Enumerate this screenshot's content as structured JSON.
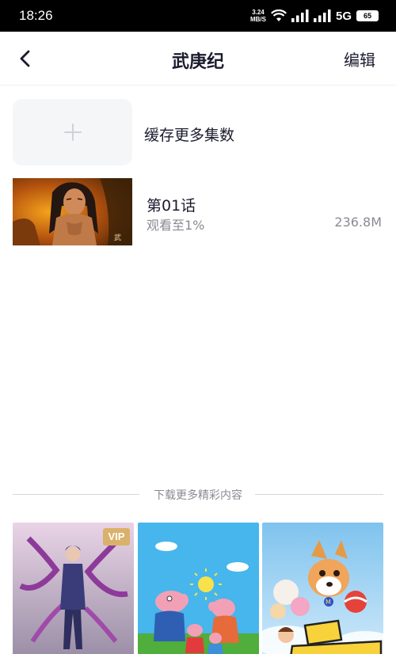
{
  "status_bar": {
    "time": "18:26",
    "net_speed_value": "3.24",
    "net_speed_unit": "MB/S",
    "network_type": "5G",
    "battery": "65"
  },
  "header": {
    "title": "武庚纪",
    "edit_label": "编辑"
  },
  "cache_more": {
    "label": "缓存更多集数"
  },
  "episode": {
    "title": "第01话",
    "progress": "观看至1%",
    "size": "236.8M"
  },
  "recommend_section": {
    "label": "下载更多精彩内容"
  },
  "recommendations": [
    {
      "badge": "VIP"
    },
    {},
    {}
  ]
}
